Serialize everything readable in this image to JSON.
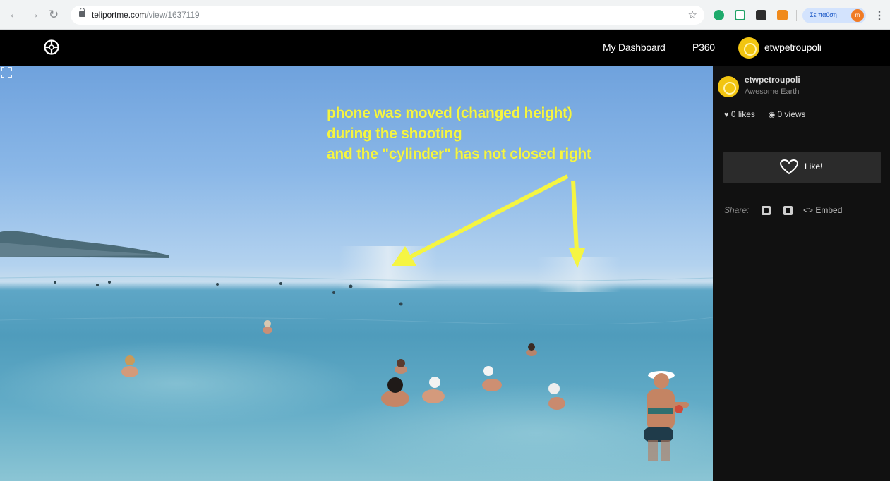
{
  "browser": {
    "url_host": "teliportme.com",
    "url_path": "/view/1637119",
    "profile_label": "Σε παύση",
    "profile_initial": "m"
  },
  "header": {
    "links": [
      {
        "label": "My Dashboard"
      },
      {
        "label": "P360"
      }
    ],
    "username": "etwpetroupoli"
  },
  "viewer": {
    "annotation_lines": [
      "phone was moved (changed height)",
      "during the shooting",
      "and the \"cylinder\" has not closed right"
    ],
    "annotation_color": "#f5f542"
  },
  "sidebar": {
    "username": "etwpetroupoli",
    "category": "Awesome Earth",
    "likes": "0 likes",
    "views": "0 views",
    "like_button": "Like!",
    "share_label": "Share:",
    "embed_label": "<> Embed"
  },
  "colors": {
    "avatar": "#f2c511",
    "header_bg": "#000000",
    "sidebar_bg": "#111111"
  }
}
